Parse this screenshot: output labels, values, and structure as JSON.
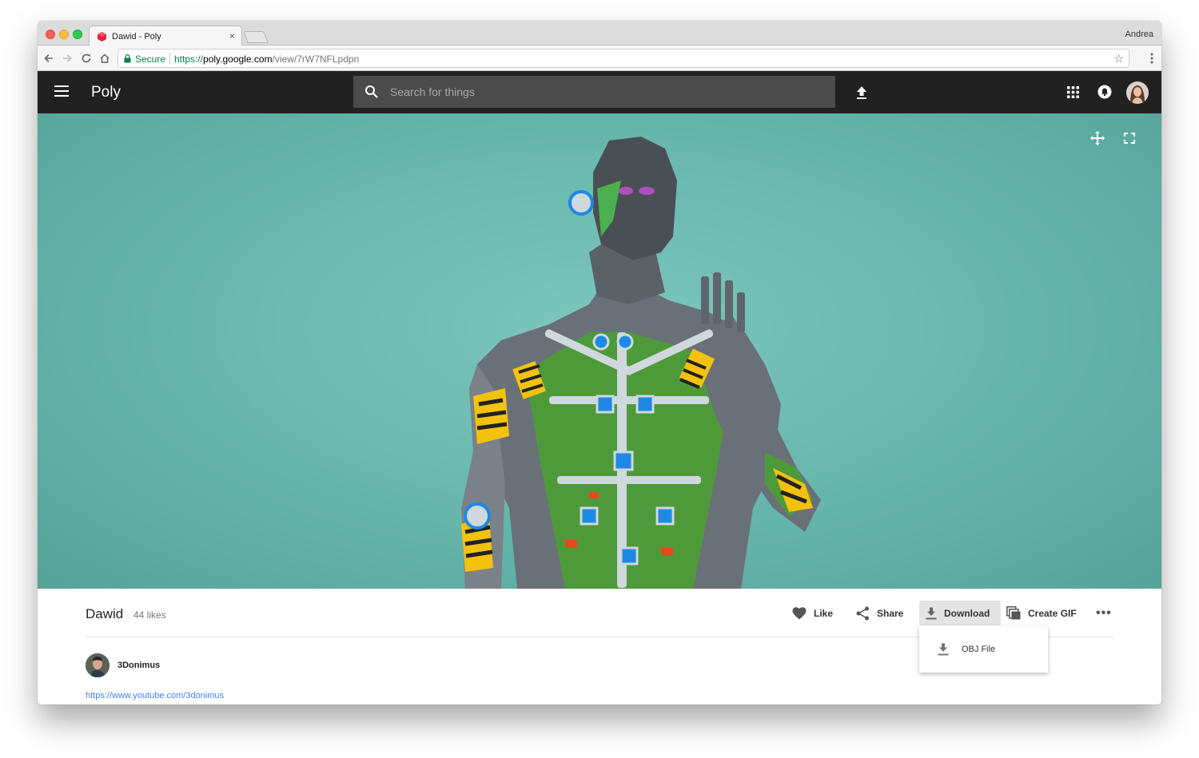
{
  "browser": {
    "tab_title": "Dawid - Poly",
    "tab_close": "×",
    "profile_name": "Andrea",
    "secure_label": "Secure",
    "url_scheme": "https://",
    "url_host": "poly.google.com",
    "url_path": "/view/7rW7NFLpdpn",
    "star": "☆",
    "icons": [
      "back-arrow-icon",
      "forward-arrow-icon",
      "reload-icon",
      "home-icon",
      "lock-icon",
      "star-icon",
      "menu-dots-icon"
    ]
  },
  "appbar": {
    "brand": "Poly",
    "search_placeholder": "Search for things",
    "icons": [
      "hamburger-icon",
      "search-icon",
      "upload-icon",
      "apps-grid-icon",
      "notifications-icon",
      "avatar"
    ]
  },
  "viewer": {
    "background": "#6bbab0",
    "icons": [
      "move-icon",
      "fullscreen-icon"
    ]
  },
  "asset": {
    "title": "Dawid",
    "likes": "44 likes",
    "actions": {
      "like": "Like",
      "share": "Share",
      "download": "Download",
      "create_gif": "Create GIF",
      "more": "•••"
    },
    "author": "3Donimus",
    "link": "https://www.youtube.com/3donimus"
  },
  "download_menu": {
    "items": [
      {
        "label": "OBJ File",
        "icon": "download-icon"
      }
    ]
  },
  "colors": {
    "appbar": "#212121",
    "secure_green": "#0b8043",
    "link_blue": "#4285f4",
    "favicon_red": "#e8223f"
  }
}
